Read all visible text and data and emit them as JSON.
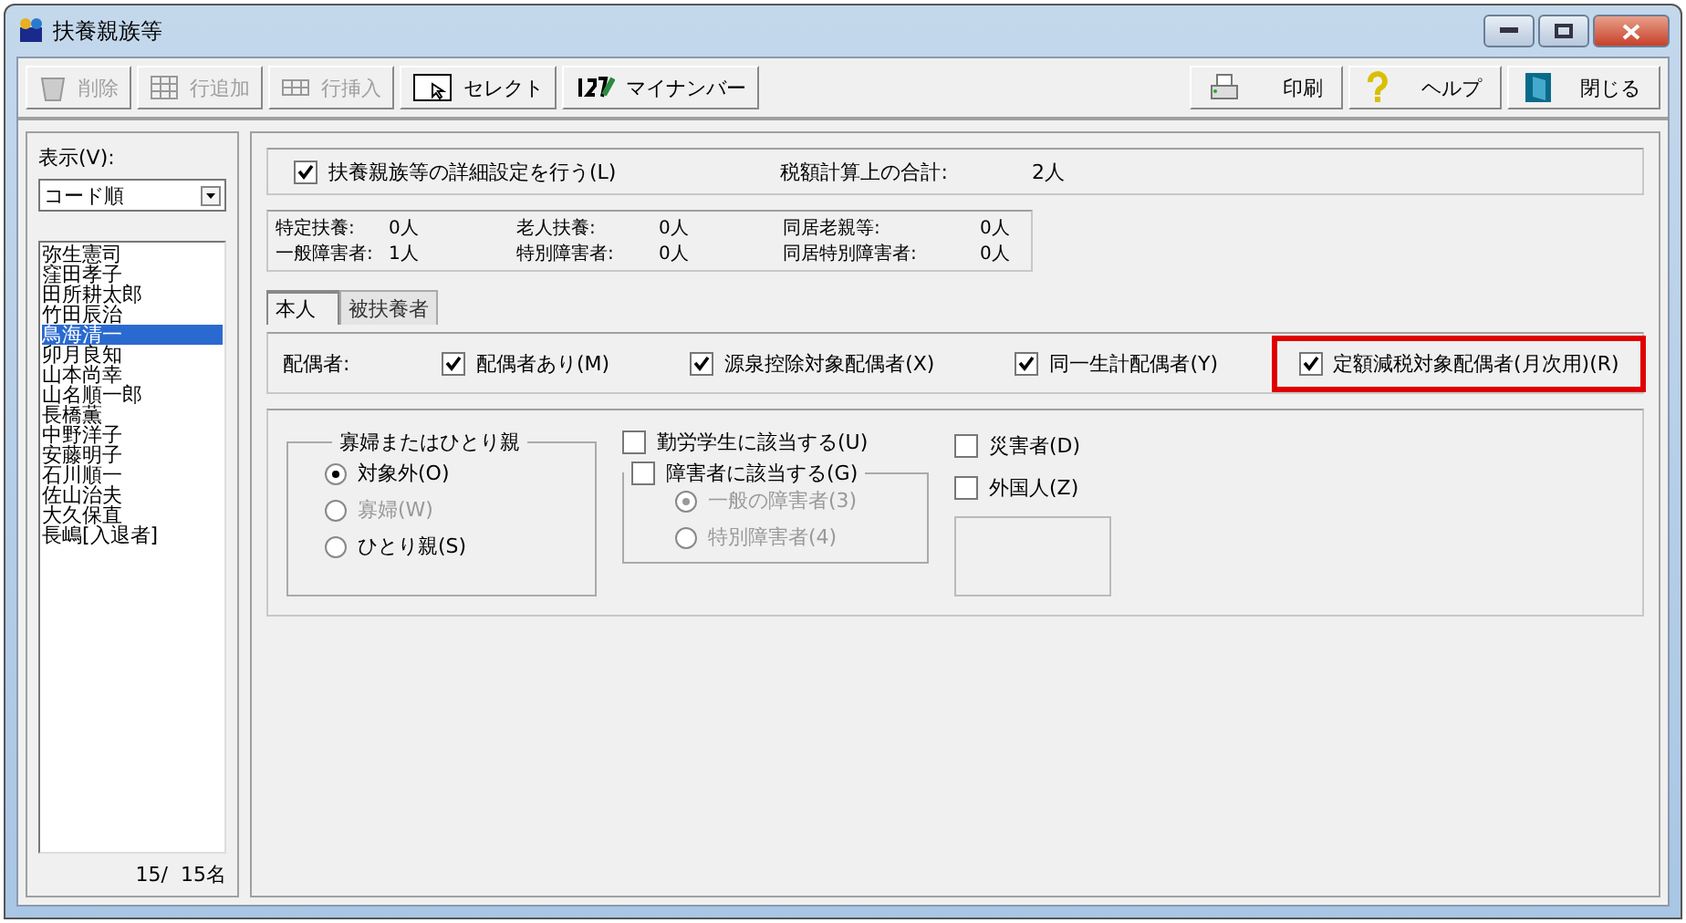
{
  "window": {
    "title": "扶養親族等"
  },
  "toolbar": {
    "left": [
      {
        "kind": "delete",
        "label": "削除",
        "disabled": true
      },
      {
        "kind": "add",
        "label": "行追加",
        "disabled": true
      },
      {
        "kind": "insert",
        "label": "行挿入",
        "disabled": true
      },
      {
        "kind": "select",
        "label": "セレクト",
        "disabled": false
      },
      {
        "kind": "number",
        "label": "マイナンバー",
        "disabled": false
      }
    ],
    "right": [
      {
        "kind": "print",
        "label": "印刷",
        "disabled": false
      },
      {
        "kind": "help",
        "label": "ヘルプ",
        "disabled": false
      },
      {
        "kind": "close",
        "label": "閉じる",
        "disabled": false
      }
    ]
  },
  "sidebar": {
    "display_label": "表示(V):",
    "sort_select": "コード順",
    "names": [
      {
        "name": "弥生憲司",
        "selected": false
      },
      {
        "name": "窪田孝子",
        "selected": false
      },
      {
        "name": "田所耕太郎",
        "selected": false
      },
      {
        "name": "竹田辰治",
        "selected": false
      },
      {
        "name": "鳥海清一",
        "selected": true
      },
      {
        "name": "卯月良知",
        "selected": false
      },
      {
        "name": "山本尚幸",
        "selected": false
      },
      {
        "name": "山名順一郎",
        "selected": false
      },
      {
        "name": "長橋薫",
        "selected": false
      },
      {
        "name": "中野洋子",
        "selected": false
      },
      {
        "name": "安藤明子",
        "selected": false
      },
      {
        "name": "石川順一",
        "selected": false
      },
      {
        "name": "佐山治夫",
        "selected": false
      },
      {
        "name": "大久保直",
        "selected": false
      },
      {
        "name": "長嶋[入退者]",
        "selected": false
      }
    ],
    "count": "15/  15名"
  },
  "settings": {
    "detail": {
      "label": "扶養親族等の詳細設定を行う(L)",
      "checked": true
    },
    "total_label": "税額計算上の合計:",
    "total_value": "2人"
  },
  "counts": [
    {
      "label": "特定扶養:",
      "value": "0人"
    },
    {
      "label": "老人扶養:",
      "value": "0人"
    },
    {
      "label": "同居老親等:",
      "value": "0人"
    },
    {
      "label": "一般障害者:",
      "value": "1人"
    },
    {
      "label": "特別障害者:",
      "value": "0人"
    },
    {
      "label": "同居特別障害者:",
      "value": "0人"
    }
  ],
  "tabs": [
    {
      "label": "本人",
      "selected": true
    },
    {
      "label": "被扶養者",
      "selected": false
    }
  ],
  "spouse": {
    "label": "配偶者:",
    "options": [
      {
        "label": "配偶者あり(M)",
        "checked": true,
        "highlighted": false
      },
      {
        "label": "源泉控除対象配偶者(X)",
        "checked": true,
        "highlighted": false
      },
      {
        "label": "同一生計配偶者(Y)",
        "checked": true,
        "highlighted": false
      },
      {
        "label": "定額減税対象配偶者(月次用)(R)",
        "checked": true,
        "highlighted": true
      }
    ]
  },
  "widow_group": {
    "title": "寡婦またはひとり親",
    "options": [
      {
        "label": "対象外(O)",
        "selected": true,
        "disabled": false
      },
      {
        "label": "寡婦(W)",
        "selected": false,
        "disabled": true
      },
      {
        "label": "ひとり親(S)",
        "selected": false,
        "disabled": false
      }
    ]
  },
  "student": {
    "label": "勤労学生に該当する(U)",
    "checked": false
  },
  "disability": {
    "label": "障害者に該当する(G)",
    "checked": false,
    "options": [
      {
        "label": "一般の障害者(3)",
        "selected": true,
        "disabled": true
      },
      {
        "label": "特別障害者(4)",
        "selected": false,
        "disabled": true
      }
    ]
  },
  "disaster": {
    "label": "災害者(D)",
    "checked": false
  },
  "foreigner": {
    "label": "外国人(Z)",
    "checked": false
  }
}
